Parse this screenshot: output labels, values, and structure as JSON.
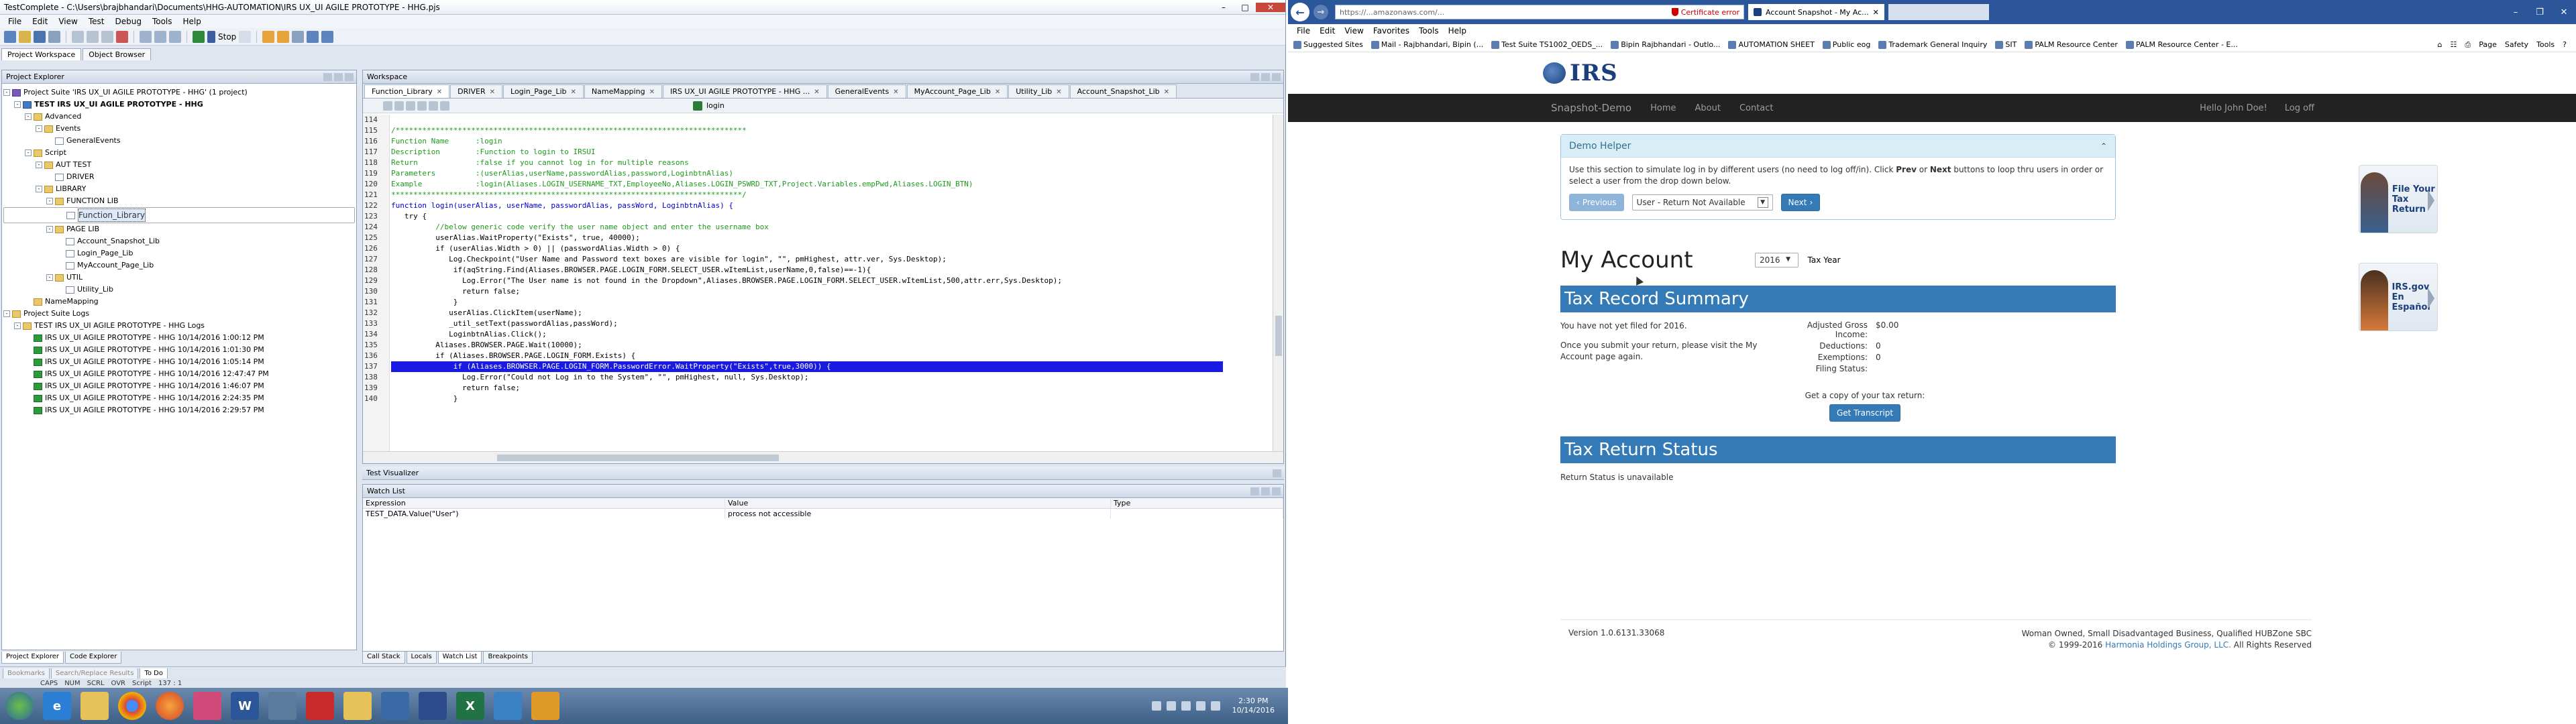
{
  "tc": {
    "title": "TestComplete - C:\\Users\\brajbhandari\\Documents\\HHG-AUTOMATION\\IRS UX_UI AGILE PROTOTYPE - HHG.pjs",
    "menu": [
      "File",
      "Edit",
      "View",
      "Test",
      "Debug",
      "Tools",
      "Help"
    ],
    "stop_label": "Stop",
    "top_tabs": [
      "Project Workspace",
      "Object Browser"
    ],
    "explorer_title": "Project Explorer",
    "tree": [
      {
        "label": "Project Suite 'IRS UX_UI AGILE PROTOTYPE - HHG' (1 project)",
        "level": 0,
        "icon": "suite",
        "exp": "-",
        "bold": false
      },
      {
        "label": "TEST IRS UX_UI AGILE PROTOTYPE - HHG",
        "level": 1,
        "icon": "proj",
        "exp": "-",
        "bold": true
      },
      {
        "label": "Advanced",
        "level": 2,
        "icon": "folder",
        "exp": "-",
        "bold": false
      },
      {
        "label": "Events",
        "level": 3,
        "icon": "folder",
        "exp": "-",
        "bold": false
      },
      {
        "label": "GeneralEvents",
        "level": 4,
        "icon": "file",
        "exp": "",
        "bold": false
      },
      {
        "label": "Script",
        "level": 2,
        "icon": "folder",
        "exp": "-",
        "bold": false
      },
      {
        "label": "AUT TEST",
        "level": 3,
        "icon": "folder",
        "exp": "-",
        "bold": false
      },
      {
        "label": "DRIVER",
        "level": 4,
        "icon": "file",
        "exp": "",
        "bold": false
      },
      {
        "label": "LIBRARY",
        "level": 3,
        "icon": "folder",
        "exp": "-",
        "bold": false
      },
      {
        "label": "FUNCTION LIB",
        "level": 4,
        "icon": "folder",
        "exp": "-",
        "bold": false
      },
      {
        "label": "Function_Library",
        "level": 5,
        "icon": "file",
        "exp": "",
        "bold": false,
        "selected": true
      },
      {
        "label": "PAGE LIB",
        "level": 4,
        "icon": "folder",
        "exp": "-",
        "bold": false
      },
      {
        "label": "Account_Snapshot_Lib",
        "level": 5,
        "icon": "file",
        "exp": "",
        "bold": false
      },
      {
        "label": "Login_Page_Lib",
        "level": 5,
        "icon": "file",
        "exp": "",
        "bold": false
      },
      {
        "label": "MyAccount_Page_Lib",
        "level": 5,
        "icon": "file",
        "exp": "",
        "bold": false
      },
      {
        "label": "UTIL",
        "level": 4,
        "icon": "folder",
        "exp": "-",
        "bold": false
      },
      {
        "label": "Utility_Lib",
        "level": 5,
        "icon": "file",
        "exp": "",
        "bold": false
      },
      {
        "label": "NameMapping",
        "level": 2,
        "icon": "folder",
        "exp": "",
        "bold": false
      },
      {
        "label": "Project Suite Logs",
        "level": 0,
        "icon": "folder",
        "exp": "-",
        "bold": false
      },
      {
        "label": "TEST IRS UX_UI AGILE PROTOTYPE - HHG Logs",
        "level": 1,
        "icon": "folder",
        "exp": "-",
        "bold": false
      },
      {
        "label": "IRS UX_UI AGILE PROTOTYPE - HHG 10/14/2016 1:00:12 PM",
        "level": 2,
        "icon": "ok",
        "exp": "",
        "bold": false
      },
      {
        "label": "IRS UX_UI AGILE PROTOTYPE - HHG 10/14/2016 1:01:30 PM",
        "level": 2,
        "icon": "ok",
        "exp": "",
        "bold": false
      },
      {
        "label": "IRS UX_UI AGILE PROTOTYPE - HHG 10/14/2016 1:05:14 PM",
        "level": 2,
        "icon": "ok",
        "exp": "",
        "bold": false
      },
      {
        "label": "IRS UX_UI AGILE PROTOTYPE - HHG 10/14/2016 12:47:47 PM",
        "level": 2,
        "icon": "ok",
        "exp": "",
        "bold": false
      },
      {
        "label": "IRS UX_UI AGILE PROTOTYPE - HHG 10/14/2016 1:46:07 PM",
        "level": 2,
        "icon": "ok",
        "exp": "",
        "bold": false
      },
      {
        "label": "IRS UX_UI AGILE PROTOTYPE - HHG 10/14/2016 2:24:35 PM",
        "level": 2,
        "icon": "ok",
        "exp": "",
        "bold": false
      },
      {
        "label": "IRS UX_UI AGILE PROTOTYPE - HHG 10/14/2016 2:29:57 PM",
        "level": 2,
        "icon": "ok",
        "exp": "",
        "bold": false
      }
    ],
    "workspace_title": "Workspace",
    "doc_tabs": [
      "Function_Library",
      "DRIVER",
      "Login_Page_Lib",
      "NameMapping",
      "IRS UX_UI AGILE PROTOTYPE - HHG ...",
      "GeneralEvents",
      "MyAccount_Page_Lib",
      "Utility_Lib",
      "Account_Snapshot_Lib"
    ],
    "routine": "login",
    "code": [
      {
        "n": "114",
        "t": "",
        "c": ""
      },
      {
        "n": "115",
        "t": "/*******************************************************************************",
        "c": "cm"
      },
      {
        "n": "116",
        "t": "Function Name      :login",
        "c": "cm"
      },
      {
        "n": "117",
        "t": "Description        :Function to login to IRSUI",
        "c": "cm"
      },
      {
        "n": "118",
        "t": "Return             :false if you cannot log in for multiple reasons",
        "c": "cm"
      },
      {
        "n": "119",
        "t": "Parameters         :(userAlias,userName,passwordAlias,password,LoginbtnAlias)",
        "c": "cm"
      },
      {
        "n": "120",
        "t": "Example            :login(Aliases.LOGIN_USERNAME_TXT,EmployeeNo,Aliases.LOGIN_PSWRD_TXT,Project.Variables.empPwd,Aliases.LOGIN_BTN)",
        "c": "cm"
      },
      {
        "n": "121",
        "t": "*******************************************************************************/",
        "c": "cm"
      },
      {
        "n": "122",
        "t": "function login(userAlias, userName, passwordAlias, passWord, LoginbtnAlias) {",
        "c": "kw"
      },
      {
        "n": "123",
        "t": "   try {",
        "c": ""
      },
      {
        "n": "124",
        "t": "          //below generic code verify the user name object and enter the username box",
        "c": "cm"
      },
      {
        "n": "125",
        "t": "          userAlias.WaitProperty(\"Exists\", true, 40000);",
        "c": ""
      },
      {
        "n": "126",
        "t": "          if (userAlias.Width > 0) || (passwordAlias.Width > 0) {",
        "c": ""
      },
      {
        "n": "127",
        "t": "             Log.Checkpoint(\"User Name and Password text boxes are visible for login\", \"\", pmHighest, attr.ver, Sys.Desktop);",
        "c": ""
      },
      {
        "n": "128",
        "t": "              if(aqString.Find(Aliases.BROWSER.PAGE.LOGIN_FORM.SELECT_USER.wItemList,userName,0,false)==-1){",
        "c": ""
      },
      {
        "n": "129",
        "t": "                Log.Error(\"The User name is not found in the Dropdown\",Aliases.BROWSER.PAGE.LOGIN_FORM.SELECT_USER.wItemList,500,attr.err,Sys.Desktop);",
        "c": ""
      },
      {
        "n": "130",
        "t": "                return false;",
        "c": ""
      },
      {
        "n": "131",
        "t": "              }",
        "c": ""
      },
      {
        "n": "132",
        "t": "             userAlias.ClickItem(userName);",
        "c": ""
      },
      {
        "n": "133",
        "t": "             _util_setText(passwordAlias,passWord);",
        "c": ""
      },
      {
        "n": "134",
        "t": "             LoginbtnAlias.Click();",
        "c": ""
      },
      {
        "n": "135",
        "t": "          Aliases.BROWSER.PAGE.Wait(10000);",
        "c": ""
      },
      {
        "n": "136",
        "t": "          if (Aliases.BROWSER.PAGE.LOGIN_FORM.Exists) {",
        "c": ""
      },
      {
        "n": "137",
        "t": "              if (Aliases.BROWSER.PAGE.LOGIN_FORM.PasswordError.WaitProperty(\"Exists\",true,3000)) {",
        "c": "hl"
      },
      {
        "n": "138",
        "t": "                Log.Error(\"Could not Log in to the System\", \"\", pmHighest, null, Sys.Desktop);",
        "c": ""
      },
      {
        "n": "139",
        "t": "                return false;",
        "c": ""
      },
      {
        "n": "140",
        "t": "              }",
        "c": ""
      }
    ],
    "visualizer_title": "Test Visualizer",
    "watch_title": "Watch List",
    "watch_cols": [
      "Expression",
      "Value",
      "Type"
    ],
    "watch_rows": [
      {
        "expr": "TEST_DATA.Value(\"User\")",
        "value": "process not accessible",
        "type": ""
      }
    ],
    "bottom_tabs_left": [
      "Project Explorer",
      "Code Explorer"
    ],
    "bottom_tabs_right": [
      "Call Stack",
      "Locals",
      "Watch List",
      "Breakpoints"
    ],
    "sub_tabs": [
      "Bookmarks",
      "Search/Replace Results",
      "To Do"
    ],
    "status": [
      "CAPS",
      "NUM",
      "SCRL",
      "OVR",
      "Script",
      "137 : 1"
    ]
  },
  "taskbar": {
    "apps": [
      "start",
      "ie",
      "explorer",
      "chrome",
      "firefox",
      "app1",
      "word",
      "app2",
      "acrobat",
      "outlook",
      "testcomplete",
      "app3",
      "excel",
      "app4",
      "app5"
    ],
    "time": "2:30 PM",
    "date": "10/14/2016"
  },
  "ie": {
    "address": "https://...amazonaws.com/...",
    "address_host": "amazonaws.com",
    "cert_error": "Certificate error",
    "tab_title": "Account Snapshot - My Ac...",
    "menu": [
      "File",
      "Edit",
      "View",
      "Favorites",
      "Tools",
      "Help"
    ],
    "favorites": [
      "Suggested Sites",
      "Mail - Rajbhandari, Bipin (...",
      "Test Suite TS1002_OEDS_...",
      "Bipin Rajbhandari - Outlo...",
      "AUTOMATION SHEET",
      "Public eog",
      "Trademark General Inquiry",
      "SIT",
      "PALM Resource Center",
      "PALM Resource Center - E..."
    ],
    "commands": [
      "Page",
      "Safety",
      "Tools"
    ]
  },
  "site": {
    "logo": "IRS",
    "brand": "Snapshot-Demo",
    "nav": [
      "Home",
      "About",
      "Contact"
    ],
    "nav_right": [
      "Hello John Doe!",
      "Log off"
    ],
    "helper": {
      "title": "Demo Helper",
      "text_pre": "Use this section to simulate log in by different users (no need to log off/in). Click ",
      "prev_word": "Prev",
      "text_mid": " or ",
      "next_word": "Next",
      "text_post": " buttons to loop thru users in order or select a user from the drop down below.",
      "prev_btn": "Previous",
      "user_select": "User - Return Not Available",
      "next_btn": "Next"
    },
    "account_title": "My Account",
    "year": "2016",
    "year_label": "Tax Year",
    "summary": {
      "title": "Tax Record Summary",
      "not_filed": "You have not yet filed for 2016.",
      "note": "Once you submit your return, please visit the My Account page again.",
      "rows": [
        {
          "label": "Adjusted Gross Income:",
          "value": "$0.00"
        },
        {
          "label": "Deductions:",
          "value": "0"
        },
        {
          "label": "Exemptions:",
          "value": "0"
        },
        {
          "label": "Filing Status:",
          "value": ""
        }
      ],
      "transcript_text": "Get a copy of your tax return:",
      "transcript_btn": "Get Transcript"
    },
    "status": {
      "title": "Tax Return Status",
      "text": "Return Status is unavailable"
    },
    "footer": {
      "version": "Version 1.0.6131.33068",
      "right1": "Woman Owned, Small Disadvantaged Business, Qualified HUBZone SBC",
      "right2_pre": "© 1999-2016 ",
      "right2_link": "Harmonia Holdings Group, LLC.",
      "right2_post": " All Rights Reserved"
    },
    "promos": [
      {
        "line1": "File Your",
        "line2": "Tax Return"
      },
      {
        "line1": "IRS.gov",
        "line2": "En Español"
      }
    ]
  }
}
